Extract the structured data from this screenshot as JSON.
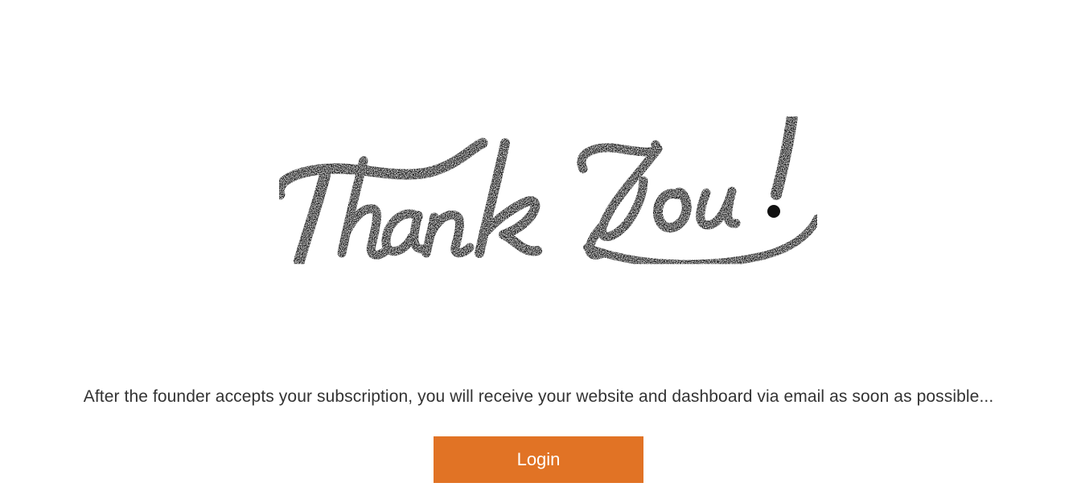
{
  "hero": {
    "image_name": "thank-you-lettering",
    "text": "Thank You!"
  },
  "message": "After the founder accepts your subscription, you will receive your website and dashboard via email as soon as possible...",
  "login_button": {
    "label": "Login",
    "color": "#E17325"
  },
  "colors": {
    "background": "#FFFFFF",
    "text": "#333333",
    "lettering": "#111111"
  }
}
